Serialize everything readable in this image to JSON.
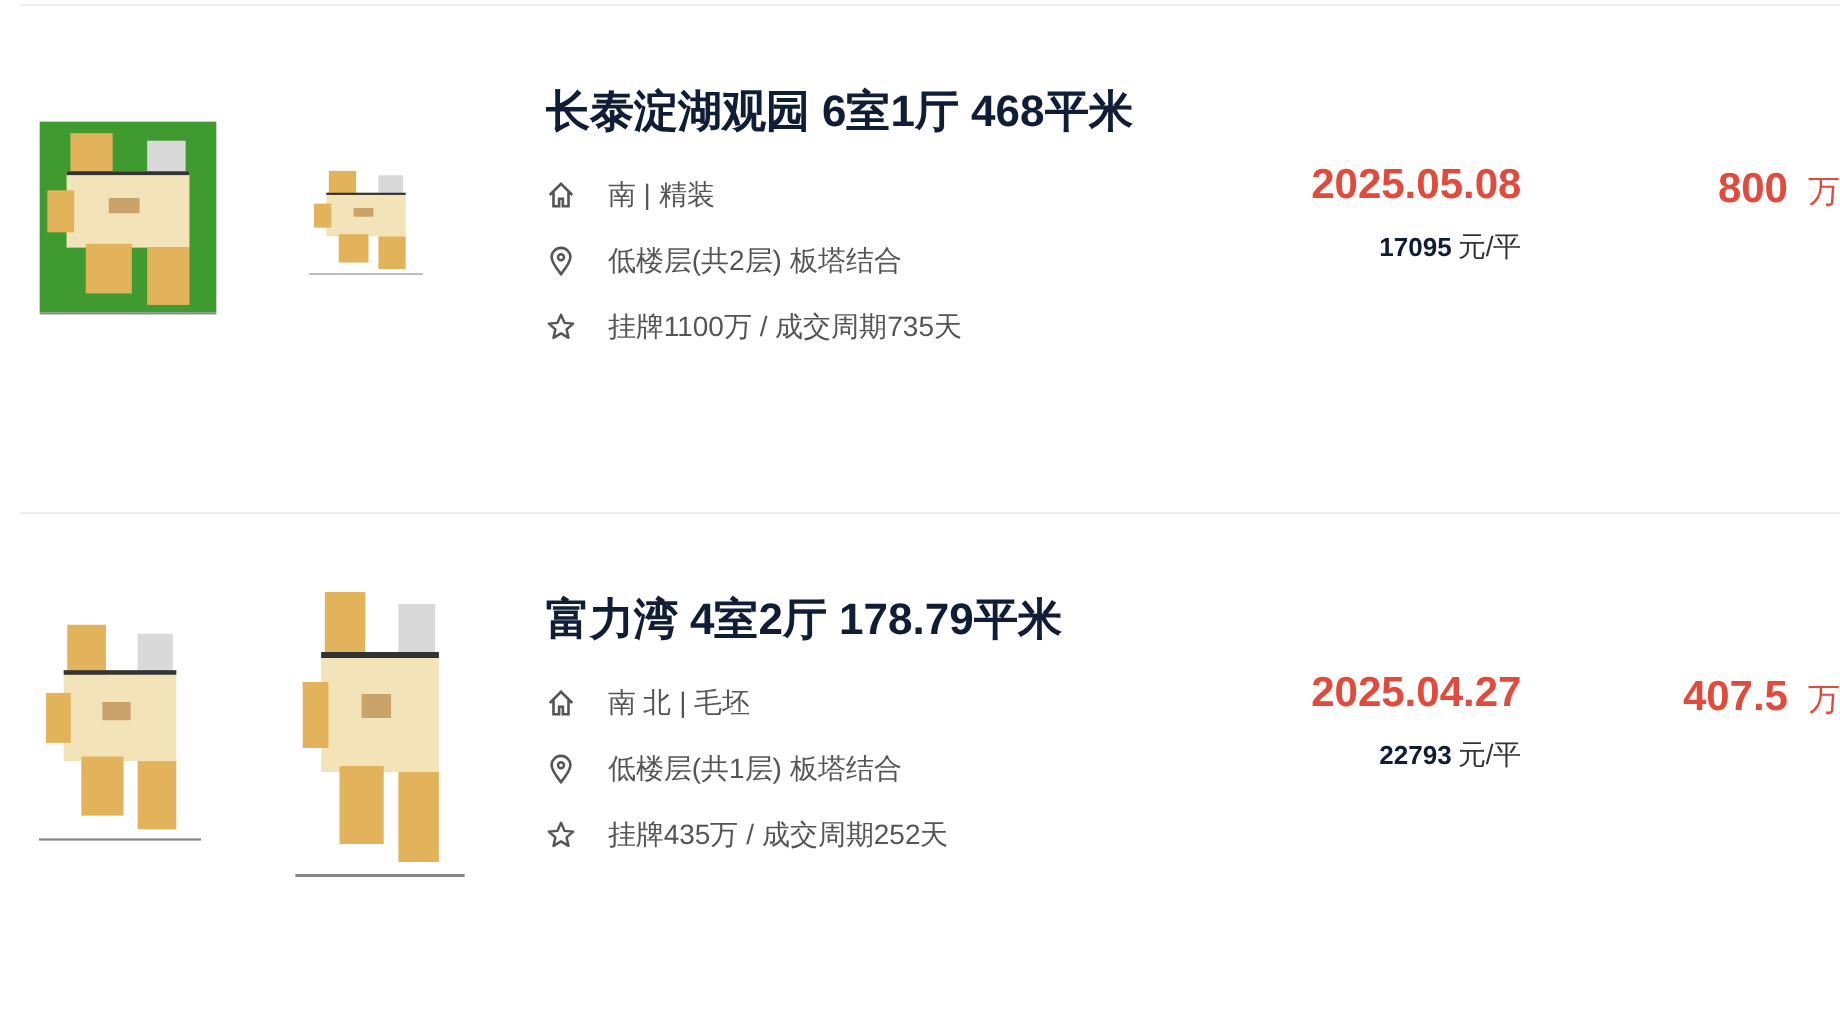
{
  "listings": [
    {
      "title": "长泰淀湖观园 6室1厅 468平米",
      "orientation": "南 | 精装",
      "floor": "低楼层(共2层) 板塔结合",
      "listing_info": "挂牌1100万 / 成交周期735天",
      "deal_date": "2025.05.08",
      "unit_price": "17095",
      "unit_price_unit": "元/平",
      "total_price": "800",
      "total_price_unit": "万"
    },
    {
      "title": "富力湾 4室2厅 178.79平米",
      "orientation": "南 北 | 毛坯",
      "floor": "低楼层(共1层) 板塔结合",
      "listing_info": "挂牌435万 / 成交周期252天",
      "deal_date": "2025.04.27",
      "unit_price": "22793",
      "unit_price_unit": "元/平",
      "total_price": "407.5",
      "total_price_unit": "万"
    }
  ]
}
